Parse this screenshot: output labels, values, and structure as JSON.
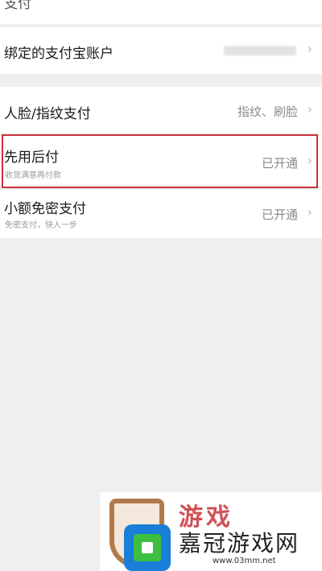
{
  "top_partial": {
    "label": "支付"
  },
  "bound_account": {
    "label": "绑定的支付宝账户"
  },
  "face_fingerprint": {
    "label": "人脸/指纹支付",
    "value": "指纹、刷脸"
  },
  "pay_later": {
    "label": "先用后付",
    "sub": "收货满意再付款",
    "value": "已开通"
  },
  "small_amount": {
    "label": "小额免密支付",
    "sub": "免密支付，快人一步",
    "value": "已开通"
  },
  "chevron": "›",
  "watermark": {
    "brand": "游戏",
    "name": "嘉冠游戏网",
    "url": "www.03mm.net"
  },
  "colors": {
    "highlight": "#c9333b",
    "background": "#efefef"
  }
}
